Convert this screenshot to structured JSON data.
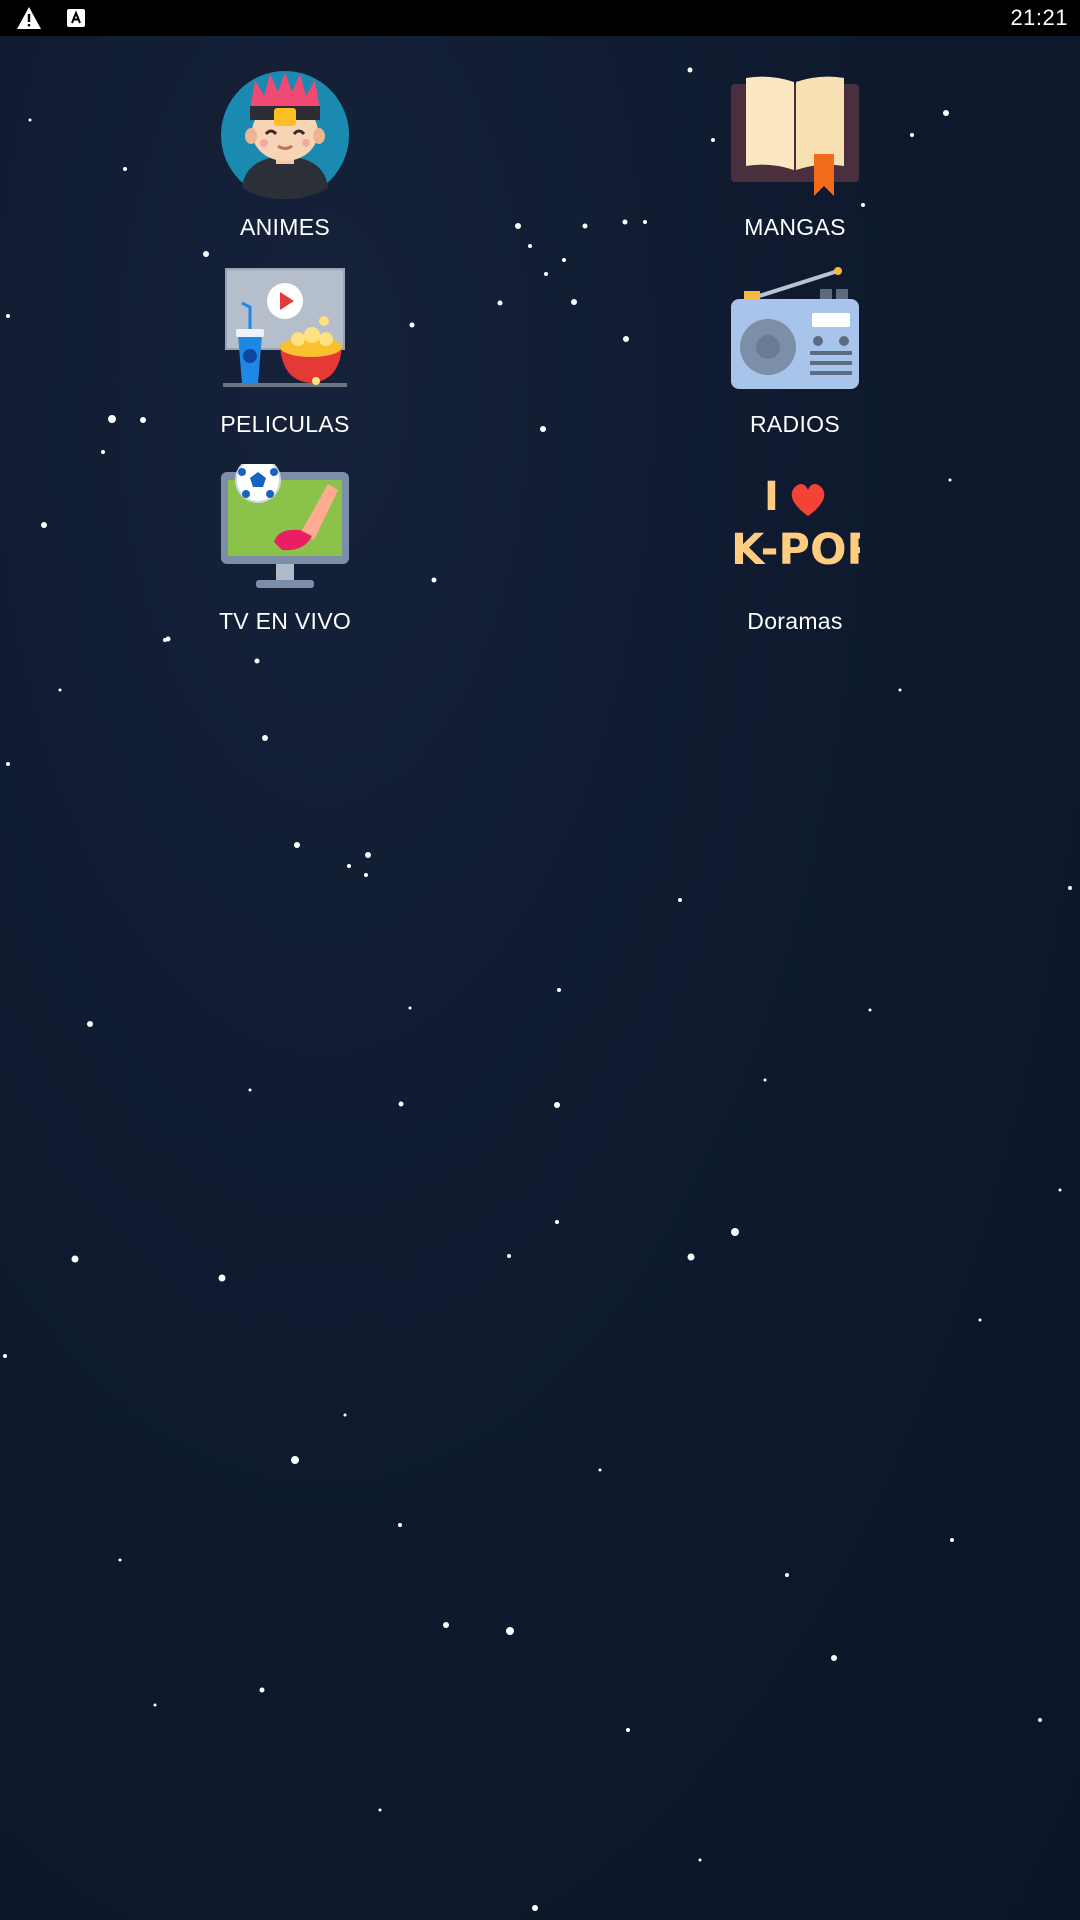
{
  "status_bar": {
    "time": "21:21",
    "icons": [
      "warning-icon",
      "a-box-icon"
    ]
  },
  "apps": [
    {
      "label": "ANIMES",
      "icon": "anime-boy-icon"
    },
    {
      "label": "MANGAS",
      "icon": "open-book-icon"
    },
    {
      "label": "PELICULAS",
      "icon": "movie-popcorn-icon"
    },
    {
      "label": "RADIOS",
      "icon": "radio-icon"
    },
    {
      "label": "TV EN VIVO",
      "icon": "tv-soccer-icon"
    },
    {
      "label": "Doramas",
      "icon": "kpop-heart-icon"
    }
  ],
  "kpop_icon_text": {
    "top": "I",
    "bottom": "K-POP"
  },
  "colors": {
    "status_bar": "#000000",
    "background": "#0e1a30",
    "label": "#ffffff"
  }
}
